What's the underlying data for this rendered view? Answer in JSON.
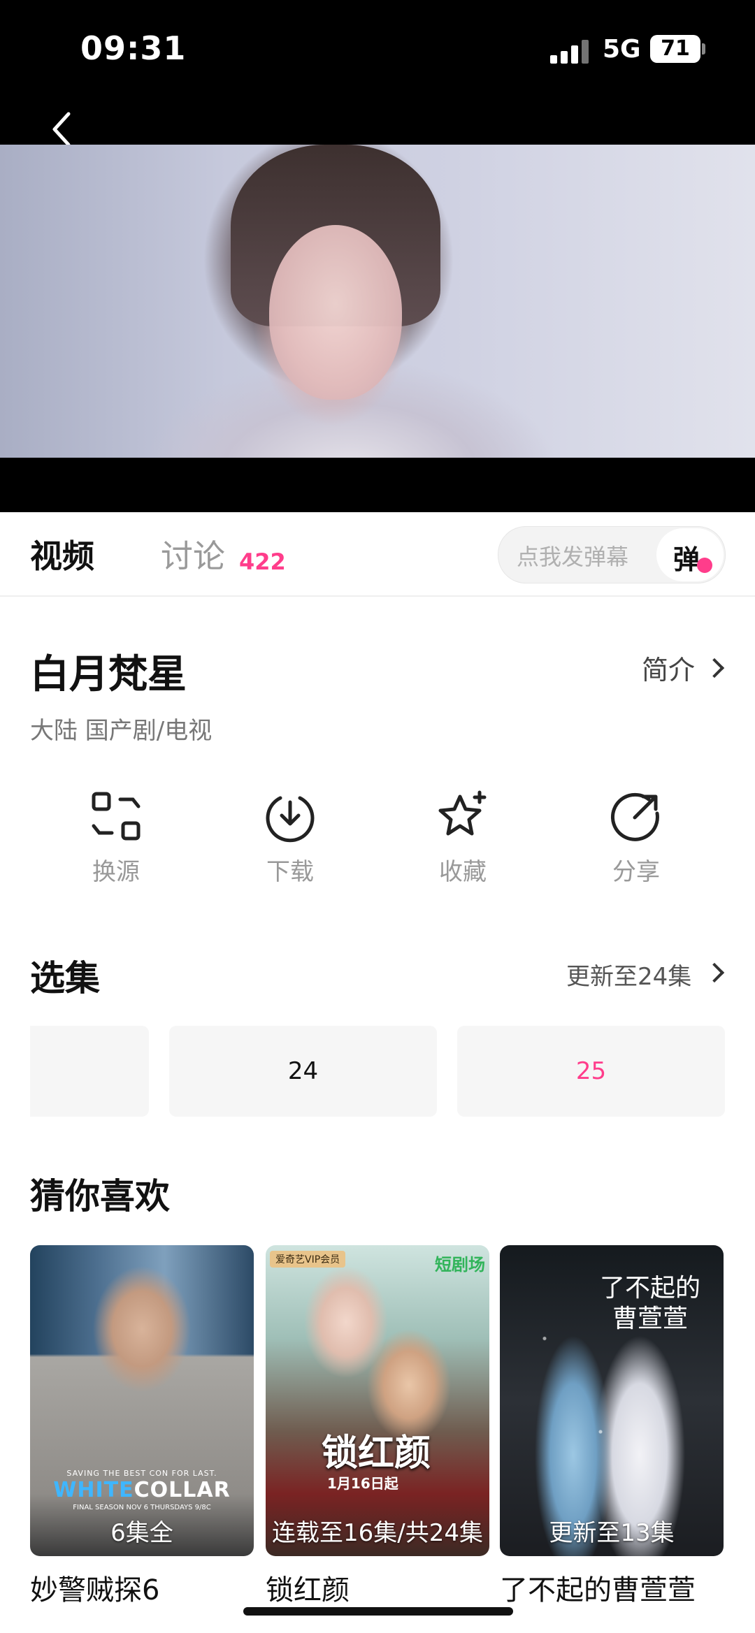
{
  "status_bar": {
    "time": "09:31",
    "network": "5G",
    "battery": "71"
  },
  "tabs": {
    "video": "视频",
    "discuss": "讨论",
    "discuss_count": "422"
  },
  "danmaku": {
    "placeholder": "点我发弹幕",
    "button": "弹"
  },
  "show": {
    "title": "白月梵星",
    "intro_label": "简介",
    "meta": "大陆  国产剧/电视"
  },
  "actions": [
    {
      "label": "换源",
      "icon": "switch-source-icon"
    },
    {
      "label": "下载",
      "icon": "download-icon"
    },
    {
      "label": "收藏",
      "icon": "favorite-star-icon"
    },
    {
      "label": "分享",
      "icon": "share-icon"
    }
  ],
  "episodes": {
    "title": "选集",
    "update": "更新至24集",
    "items": [
      "",
      "24",
      "25"
    ],
    "active_color": "#ff3d8b"
  },
  "recommend": {
    "title": "猜你喜欢",
    "items": [
      {
        "name": "妙警贼探6",
        "badge": "6集全",
        "poster_text": {
          "tagline": "SAVING THE BEST CON FOR LAST.",
          "title_a": "WHITE",
          "title_b": "COLLAR",
          "footer": "FINAL SEASON NOV 6 THURSDAYS 9/8C"
        }
      },
      {
        "name": "锁红颜",
        "badge": "连载至16集/共24集",
        "poster_text": {
          "vip": "爱奇艺VIP会员",
          "short": "短剧场",
          "title": "锁红颜",
          "date": "1月16日起"
        }
      },
      {
        "name": "了不起的曹萱萱",
        "badge": "更新至13集",
        "poster_text": {
          "title": "了不起的曹萱萱"
        }
      }
    ]
  },
  "colors": {
    "accent": "#ff3d8b",
    "background": "#ffffff",
    "video_bg": "#000000"
  }
}
